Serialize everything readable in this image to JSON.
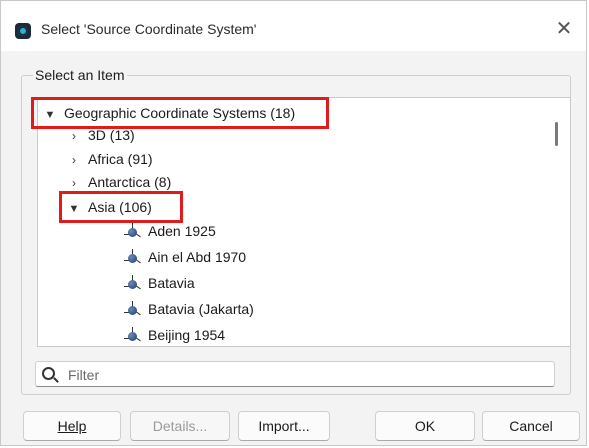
{
  "window": {
    "title": "Select 'Source Coordinate System'",
    "close_glyph": "✕"
  },
  "group": {
    "label": "Select an Item"
  },
  "tree": {
    "root": {
      "label": "Geographic Coordinate Systems (18)",
      "expanded": true
    },
    "items": [
      {
        "label": "3D (13)",
        "expanded": false
      },
      {
        "label": "Africa (91)",
        "expanded": false
      },
      {
        "label": "Antarctica (8)",
        "expanded": false
      },
      {
        "label": "Asia (106)",
        "expanded": true
      }
    ],
    "asia_children": [
      {
        "label": "Aden 1925"
      },
      {
        "label": "Ain el Abd 1970"
      },
      {
        "label": "Batavia"
      },
      {
        "label": "Batavia (Jakarta)"
      },
      {
        "label": "Beijing 1954"
      }
    ],
    "icons": {
      "collapsed": "chevron-right-icon",
      "expanded": "chevron-down-icon",
      "leaf": "geographic-coordinate-system-icon"
    }
  },
  "filter": {
    "placeholder": "Filter",
    "value": ""
  },
  "buttons": {
    "help": "Help",
    "details": "Details...",
    "import": "Import...",
    "ok": "OK",
    "cancel": "Cancel"
  },
  "colors": {
    "highlight": "#e01b1b",
    "dialog_bg": "#f3f3f3",
    "tree_bg": "#ffffff"
  }
}
